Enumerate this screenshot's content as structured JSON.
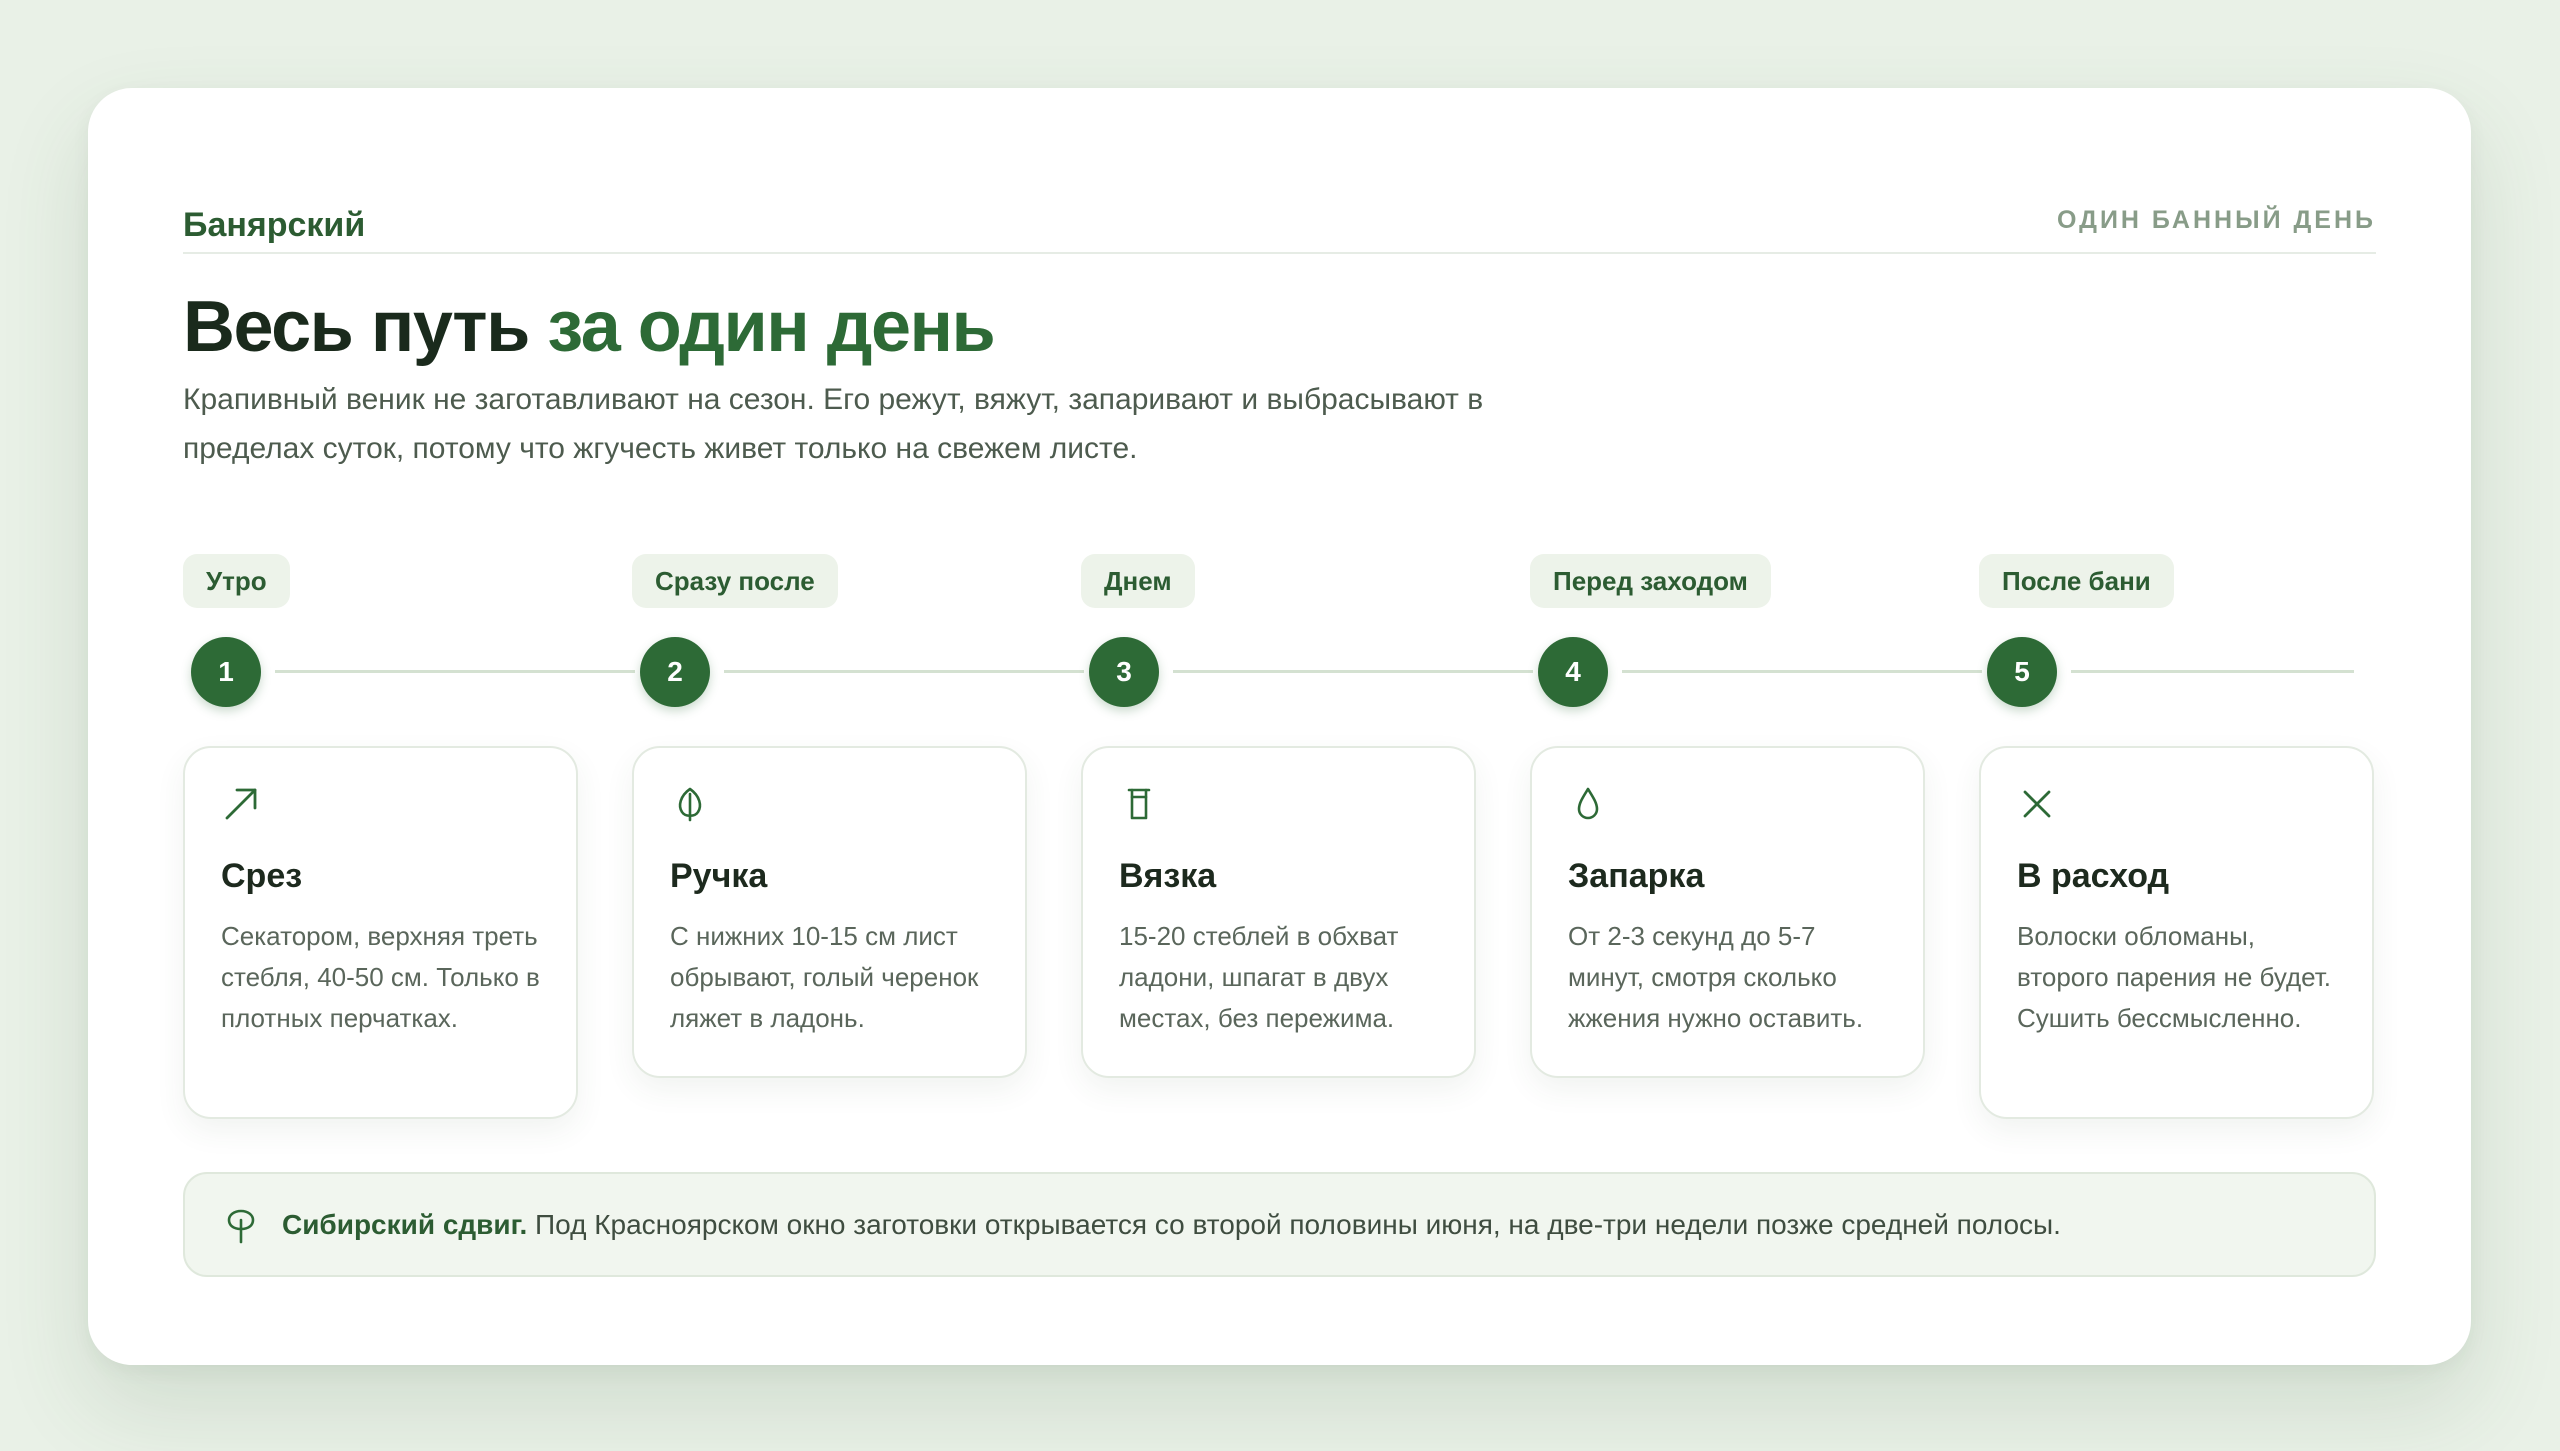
{
  "brand": "Банярский",
  "tagline": "ОДИН БАННЫЙ ДЕНЬ",
  "hero": {
    "title_part1": "Весь путь",
    "title_part2": "за один день",
    "subtitle": "Крапивный веник не заготавливают на сезон. Его режут, вяжут, запаривают и выбрасывают в пределах суток, потому что жгучесть живет только на свежем листе."
  },
  "steps": [
    {
      "stage": "Утро",
      "number": "1",
      "icon": "arrow-up-right-icon",
      "title": "Срез",
      "text": "Секатором, верхняя треть стебля, 40-50 см. Только в плотных перчатках."
    },
    {
      "stage": "Сразу после",
      "number": "2",
      "icon": "leaf-icon",
      "title": "Ручка",
      "text": "С нижних 10-15 см лист обрывают, голый черенок ляжет в ладонь."
    },
    {
      "stage": "Днем",
      "number": "3",
      "icon": "spool-icon",
      "title": "Вязка",
      "text": "15-20 стеблей в обхват ладони, шпагат в двух местах, без пережима."
    },
    {
      "stage": "Перед заходом",
      "number": "4",
      "icon": "droplet-icon",
      "title": "Запарка",
      "text": "От 2-3 секунд до 5-7 минут, смотря сколько жжения нужно оставить."
    },
    {
      "stage": "После бани",
      "number": "5",
      "icon": "close-icon",
      "title": "В расход",
      "text": "Волоски обломаны, второго парения не будет. Сушить бессмысленно."
    }
  ],
  "note": {
    "icon": "tree-icon",
    "strong": "Сибирский сдвиг.",
    "text": "Под Красноярском окно заготовки открывается со второй половины июня, на две-три недели позже средней полосы."
  },
  "colors": {
    "accent": "#2d6a36",
    "background": "#e9f1e7",
    "pill_bg": "#edf3ea",
    "note_bg": "#f1f6ef"
  }
}
